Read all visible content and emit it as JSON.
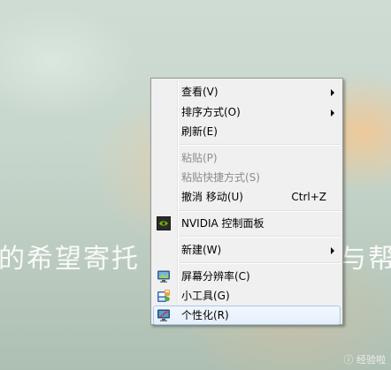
{
  "desktop": {
    "wallpaper_text_left": "的希望寄托",
    "wallpaper_text_right": "与帮",
    "watermark": "ⓘ 经验啦"
  },
  "context_menu": {
    "items": [
      {
        "label": "查看(V)",
        "submenu": true
      },
      {
        "label": "排序方式(O)",
        "submenu": true
      },
      {
        "label": "刷新(E)"
      },
      {
        "label": "粘贴(P)",
        "disabled": true
      },
      {
        "label": "粘贴快捷方式(S)",
        "disabled": true
      },
      {
        "label": "撤消 移动(U)",
        "shortcut": "Ctrl+Z"
      },
      {
        "label": "NVIDIA 控制面板",
        "icon": "nvidia-icon"
      },
      {
        "label": "新建(W)",
        "submenu": true
      },
      {
        "label": "屏幕分辨率(C)",
        "icon": "monitor-icon"
      },
      {
        "label": "小工具(G)",
        "icon": "gadgets-icon"
      },
      {
        "label": "个性化(R)",
        "icon": "personalize-icon",
        "highlighted": true
      }
    ]
  },
  "colors": {
    "menu_background": "#f0f0f0",
    "highlight_border": "#a8c9ee",
    "disabled_text": "#8d8d8d",
    "nvidia_green": "#76b900"
  }
}
